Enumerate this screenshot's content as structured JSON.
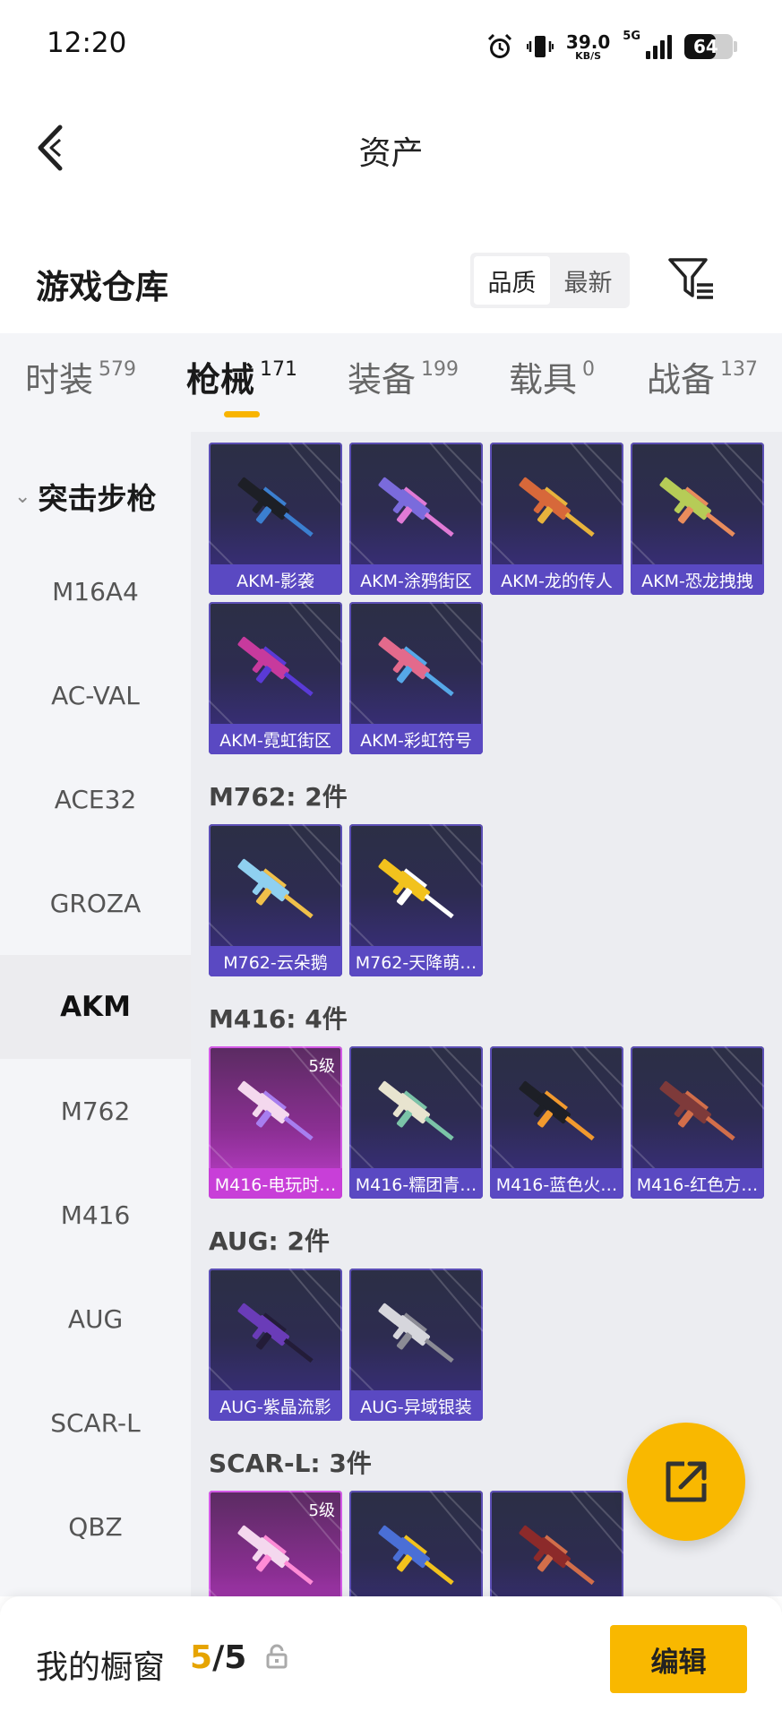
{
  "status_bar": {
    "time": "12:20",
    "net_speed": "39.0",
    "net_unit": "KB/S",
    "network": "5G",
    "battery": "64",
    "battery_level": 0.64
  },
  "header": {
    "title": "资产"
  },
  "section": {
    "title": "游戏仓库",
    "sort_options": [
      "品质",
      "最新"
    ],
    "active_sort": "品质"
  },
  "tabs": [
    {
      "label": "时装",
      "count": "579"
    },
    {
      "label": "枪械",
      "count": "171"
    },
    {
      "label": "装备",
      "count": "199"
    },
    {
      "label": "载具",
      "count": "0"
    },
    {
      "label": "战备",
      "count": "137"
    }
  ],
  "active_tab": "枪械",
  "sidebar": {
    "category": "突击步枪",
    "items": [
      "M16A4",
      "AC-VAL",
      "ACE32",
      "GROZA",
      "AKM",
      "M762",
      "M416",
      "AUG",
      "SCAR-L",
      "QBZ"
    ],
    "active": "AKM"
  },
  "groups": [
    {
      "title": "",
      "items": [
        {
          "name": "AKM-影袭",
          "level": "",
          "rarity": "purple",
          "gun_color": "#1d1f26",
          "accent": "#3b7fd0"
        },
        {
          "name": "AKM-涂鸦街区",
          "level": "",
          "rarity": "purple",
          "gun_color": "#7a6bdc",
          "accent": "#e07ad6"
        },
        {
          "name": "AKM-龙的传人",
          "level": "",
          "rarity": "purple",
          "gun_color": "#d7683a",
          "accent": "#e8b33c"
        },
        {
          "name": "AKM-恐龙拽拽",
          "level": "",
          "rarity": "purple",
          "gun_color": "#b6cc57",
          "accent": "#e98c5c"
        },
        {
          "name": "AKM-霓虹街区",
          "level": "",
          "rarity": "purple",
          "gun_color": "#c73a9d",
          "accent": "#5a3ad7"
        },
        {
          "name": "AKM-彩虹符号",
          "level": "",
          "rarity": "purple",
          "gun_color": "#e36a8c",
          "accent": "#56a8e8"
        }
      ]
    },
    {
      "title": "M762: 2件",
      "items": [
        {
          "name": "M762-云朵鹅",
          "level": "",
          "rarity": "purple",
          "gun_color": "#8fd0f0",
          "accent": "#f0c04a"
        },
        {
          "name": "M762-天降萌…",
          "level": "",
          "rarity": "purple",
          "gun_color": "#f2c21d",
          "accent": "#ffffff"
        }
      ]
    },
    {
      "title": "M416: 4件",
      "items": [
        {
          "name": "M416-电玩时…",
          "level": "5级",
          "rarity": "pink",
          "gun_color": "#f4d8ee",
          "accent": "#a77ef0"
        },
        {
          "name": "M416-糯团青…",
          "level": "",
          "rarity": "purple",
          "gun_color": "#e8e4cf",
          "accent": "#7bc4a8"
        },
        {
          "name": "M416-蓝色火…",
          "level": "",
          "rarity": "purple",
          "gun_color": "#1d1f26",
          "accent": "#f29a2e"
        },
        {
          "name": "M416-红色方…",
          "level": "",
          "rarity": "purple",
          "gun_color": "#7e3a3a",
          "accent": "#d26e4a"
        }
      ]
    },
    {
      "title": "AUG: 2件",
      "items": [
        {
          "name": "AUG-紫晶流影",
          "level": "",
          "rarity": "purple",
          "gun_color": "#6a3cb8",
          "accent": "#231c38"
        },
        {
          "name": "AUG-异域银装",
          "level": "",
          "rarity": "purple",
          "gun_color": "#d6d6dc",
          "accent": "#8b8b95"
        }
      ]
    },
    {
      "title": "SCAR-L: 3件",
      "items": [
        {
          "name": "",
          "level": "5级",
          "rarity": "pink",
          "gun_color": "#f4d8ee",
          "accent": "#ff8bd6"
        },
        {
          "name": "",
          "level": "",
          "rarity": "purple",
          "gun_color": "#4a6fd6",
          "accent": "#f2c21d"
        },
        {
          "name": "",
          "level": "",
          "rarity": "purple",
          "gun_color": "#8c2a2a",
          "accent": "#d26e4a"
        }
      ]
    }
  ],
  "bottom_bar": {
    "label": "我的橱窗",
    "current": "5",
    "separator": "/",
    "max": "5",
    "edit_label": "编辑"
  },
  "colors": {
    "accent": "#f9b800",
    "card_purple": "#5a49c2",
    "card_pink": "#c83fd8"
  }
}
